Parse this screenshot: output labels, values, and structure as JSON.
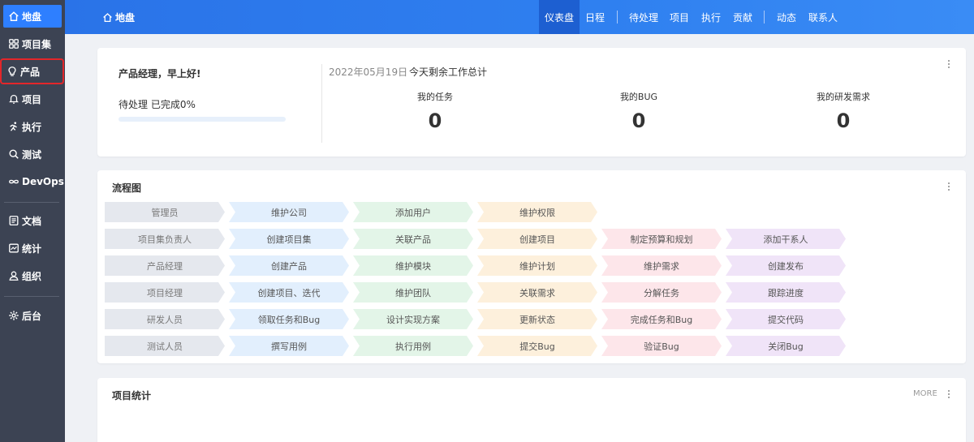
{
  "sidebar": {
    "items": [
      {
        "label": "地盘",
        "icon": "home-icon"
      },
      {
        "label": "项目集",
        "icon": "grid-icon"
      },
      {
        "label": "产品",
        "icon": "lightbulb-icon"
      },
      {
        "label": "项目",
        "icon": "bell-icon"
      },
      {
        "label": "执行",
        "icon": "run-icon"
      },
      {
        "label": "测试",
        "icon": "search-icon"
      },
      {
        "label": "DevOps",
        "icon": "infinity-icon"
      },
      {
        "label": "文档",
        "icon": "document-icon"
      },
      {
        "label": "统计",
        "icon": "chart-icon"
      },
      {
        "label": "组织",
        "icon": "user-icon"
      },
      {
        "label": "后台",
        "icon": "gear-icon"
      }
    ],
    "active_color": "#2e7fff",
    "highlight_color": "#e3262a"
  },
  "topbar": {
    "home": "地盘",
    "nav": [
      "仪表盘",
      "日程",
      "待处理",
      "项目",
      "执行",
      "贡献",
      "动态",
      "联系人"
    ]
  },
  "summary": {
    "greeting": "产品经理，早上好!",
    "progress_label": "待处理 已完成0%",
    "progress": 0,
    "date": "2022年05月19日",
    "remaining_title": "今天剩余工作总计",
    "stats": [
      {
        "label": "我的任务",
        "value": "0"
      },
      {
        "label": "我的BUG",
        "value": "0"
      },
      {
        "label": "我的研发需求",
        "value": "0"
      }
    ]
  },
  "flow": {
    "title": "流程图",
    "rows": [
      [
        "管理员",
        "维护公司",
        "添加用户",
        "维护权限"
      ],
      [
        "项目集负责人",
        "创建项目集",
        "关联产品",
        "创建项目",
        "制定预算和规划",
        "添加干系人"
      ],
      [
        "产品经理",
        "创建产品",
        "维护模块",
        "维护计划",
        "维护需求",
        "创建发布"
      ],
      [
        "项目经理",
        "创建项目、迭代",
        "维护团队",
        "关联需求",
        "分解任务",
        "跟踪进度"
      ],
      [
        "研发人员",
        "领取任务和Bug",
        "设计实现方案",
        "更新状态",
        "完成任务和Bug",
        "提交代码"
      ],
      [
        "测试人员",
        "撰写用例",
        "执行用例",
        "提交Bug",
        "验证Bug",
        "关闭Bug"
      ]
    ]
  },
  "project_stats": {
    "title": "项目统计",
    "more": "MORE"
  }
}
